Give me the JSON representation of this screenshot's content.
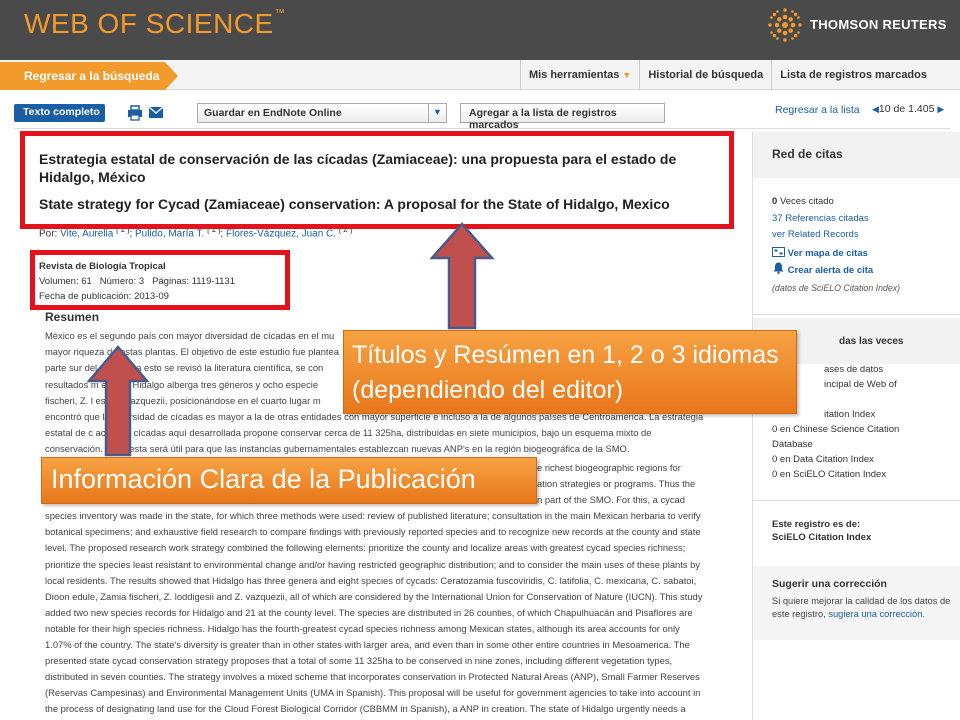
{
  "header": {
    "brand": "WEB OF SCIENCE",
    "brand_tm": "™",
    "company": "THOMSON REUTERS"
  },
  "nav": {
    "back_to_search": "Regresar a la búsqueda",
    "my_tools": "Mis herramientas",
    "search_history": "Historial de búsqueda",
    "marked_list": "Lista de registros marcados"
  },
  "toolbar": {
    "full_text": "Texto completo",
    "endnote_select": "Guardar en EndNote Online",
    "add_marked": "Agregar a la lista de registros marcados",
    "back_to_list": "Regresar a la lista",
    "current": "10",
    "of": "de",
    "total": "1.405"
  },
  "record": {
    "title_es": "Estrategia estatal de conservación de las cícadas (Zamiaceae): una propuesta para el estado de Hidalgo, México",
    "title_en": "State strategy for Cycad (Zamiaceae) conservation: A proposal for the State of Hidalgo, Mexico",
    "by_label": "Por:",
    "authors": [
      {
        "name": "Vite, Aurelia",
        "ref": "[ 1 ]"
      },
      {
        "name": "Pulido, María T.",
        "ref": "[ 1 ]"
      },
      {
        "name": "Flores-Vázquez, Juan C.",
        "ref": "[ 2 ]"
      }
    ],
    "journal": "Revista de Biología Tropical",
    "volume_label": "Volumen:",
    "volume": "61",
    "number_label": "Número:",
    "number": "3",
    "pages_label": "Páginas:",
    "pages": "1119-1131",
    "pubdate_label": "Fecha de publicación:",
    "pubdate": "2013-09",
    "resumen_heading": "Resumen",
    "abstract_es_lines": [
      "México es el segundo país con mayor diversidad de cícadas en el mu",
      "mayor riqueza de estas plantas. El objetivo de este estudio fue plantea",
      "parte sur del país, para esto se revisó la literatura científica, se con",
      "resultados m          en que Hidalgo alberga tres géneros y ocho especie",
      "fischeri, Z. l     esii, Z. vazquezii, posicionándose en el cuarto lugar m",
      "encontró que la diversidad de cícadas es mayor a la de otras entidades con mayor superficie e incluso a la de algunos países de Centroamérica. La estrategia",
      "estatal de c       ación de cícadas aquí desarrollada propone conservar cerca de 11 325ha, distribuidas en siete municipios, bajo un esquema mixto de",
      "conservación.       propuesta será útil para que las instancias gubernamentales establezcan nuevas ANP's en la región biogeográfica de la SMO."
    ],
    "abstract_en_lines": [
      "e richest biogeographic regions for",
      "ation strategies or programs. Thus the",
      "n part of the SMO. For this, a cycad",
      "species inventory was made in the state, for which three methods were used: review of published literature; consultation in the main Mexican herbaria to verify",
      "botanical specimens; and exhaustive field research to compare findings with previously reported species and to recognize new records at the county and state",
      "level. The proposed research work strategy combined the following elements: prioritize the county and localize areas with greatest cycad species richness;",
      "prioritize the species least resistant to environmental change and/or having restricted geographic distribution; and to consider the main uses of these plants by",
      "local residents. The results showed that Hidalgo has three genera and eight species of cycads: Ceratozamia fuscoviridis, C. latifolia, C. mexicana, C. sabatoi,",
      "Dioon edule, Zamia fischeri, Z. loddigesii and Z. vazquezii, all of which are considered by the International Union for Conservation of Nature (IUCN). This study",
      "added two new species records for Hidalgo and 21 at the county level. The species are distributed in 26 counties, of which Chapulhuacán and Pisaflores are",
      "notable for their high species richness. Hidalgo has the fourth-greatest cycad species richness among Mexican states, although its area accounts for only",
      "1.07% of the country. The state's diversity is greater than in other states with larger area, and even than in some other entire countries in Mesoamerica. The",
      "presented state cycad conservation strategy proposes that a total of some 11 325ha to be conserved in nine zones, including different vegetation types,",
      "distributed in seven counties. The strategy involves a mixed scheme that incorporates conservation in Protected Natural Areas (ANP), Small Farmer Reserves",
      "(Reservas Campesinas) and Environmental Management Units (UMA in Spanish). This proposal will be useful for government agencies to take into account in",
      "the process of designating land use for the Cloud Forest Biological Corridor (CBBMM in Spanish), a ANP in creation. The state of Hidalgo urgently needs a"
    ]
  },
  "sidebar": {
    "citation_network": "Red de citas",
    "times_cited_count": "0",
    "times_cited_label": "Veces citado",
    "cited_references": "37 Referencias citadas",
    "related_records": "ver Related Records",
    "citation_map": "Ver mapa de citas",
    "citation_alert": "Crear alerta de cita",
    "data_source": "(datos de SciELO Citation Index)",
    "times_used_heading": "das las veces",
    "usage_lines": [
      "ases de datos",
      "incipal de Web of",
      "",
      "itation Index",
      "0 en Chinese Science Citation",
      "Database",
      "0 en Data Citation Index",
      "0 en SciELO Citation Index"
    ],
    "record_from_label": "Este registro es de:",
    "record_from_value": "SciELO Citation Index",
    "suggest_heading": "Sugerir una corrección",
    "suggest_text": "Si quiere mejorar la calidad de los datos de este registro,",
    "suggest_link": "sugiera una corrección."
  },
  "annotations": {
    "callout_titles": "Títulos y Resúmen en 1, 2 o 3 idiomas (dependiendo del editor)",
    "callout_publication": "Información Clara de la Publicación",
    "highlight_color": "#e3121b",
    "callout_color": "#f39a2c",
    "arrow_color": "#c0504d"
  }
}
